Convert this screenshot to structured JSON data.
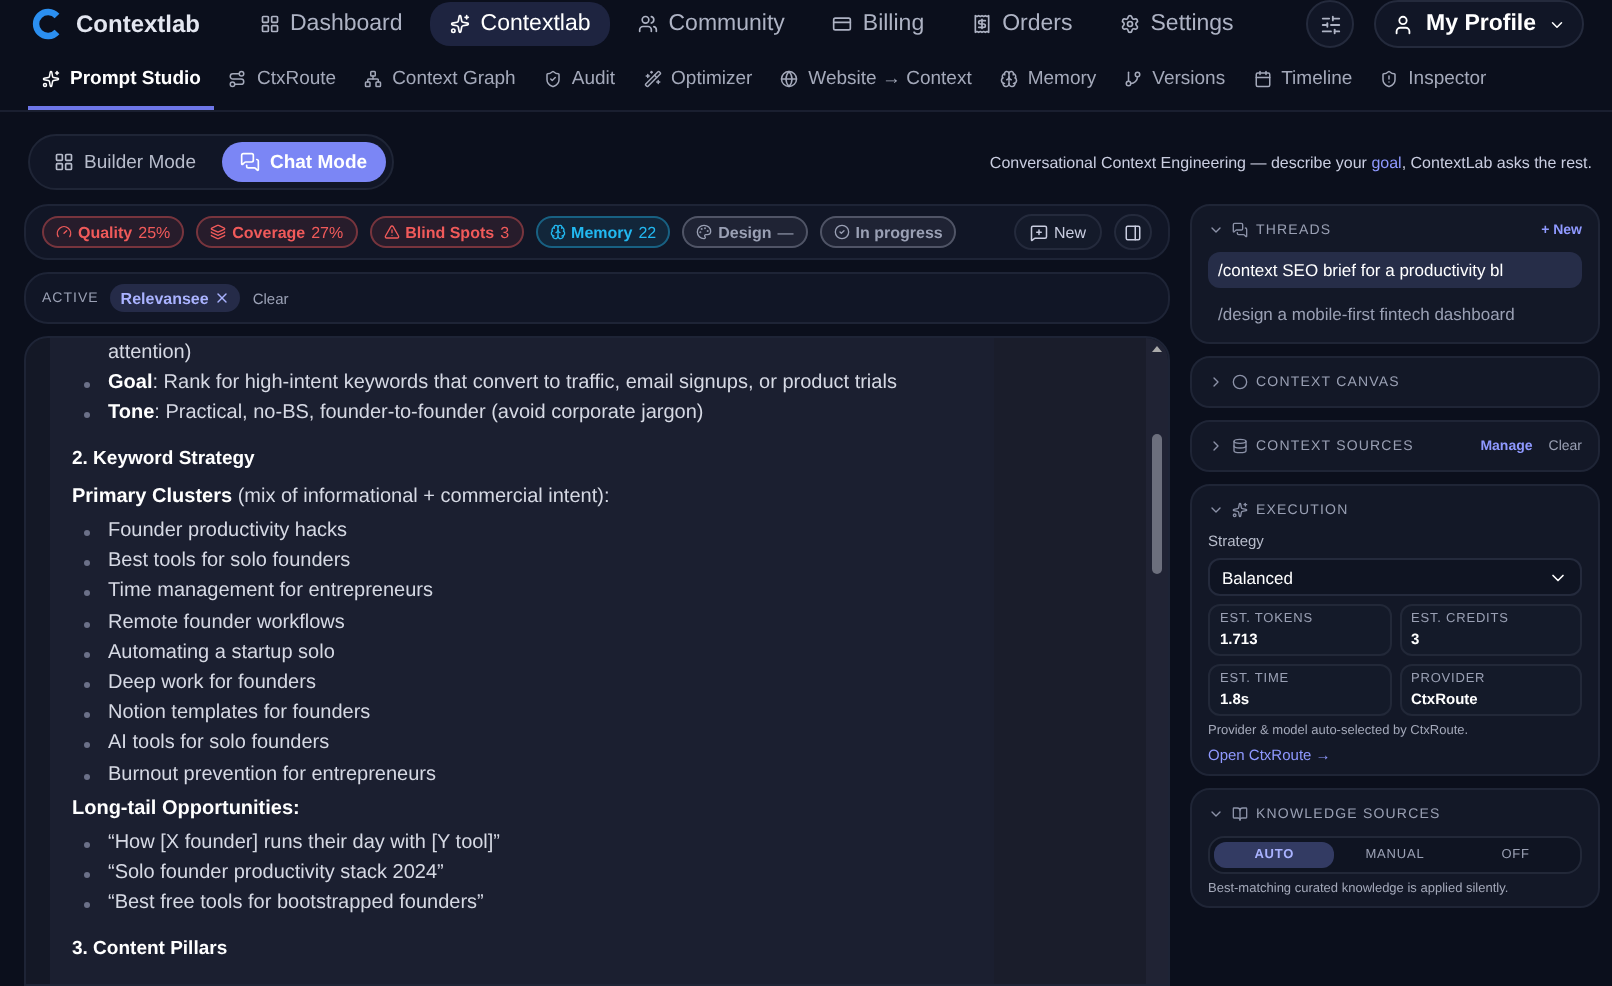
{
  "nav": {
    "brand": "Contextlab",
    "items": [
      {
        "label": "Dashboard",
        "selected": false
      },
      {
        "label": "Contextlab",
        "selected": true
      },
      {
        "label": "Community",
        "selected": false
      },
      {
        "label": "Billing",
        "selected": false
      },
      {
        "label": "Orders",
        "selected": false
      },
      {
        "label": "Settings",
        "selected": false
      }
    ],
    "profile": "My Profile"
  },
  "subtabs": [
    {
      "label": "Prompt Studio",
      "selected": true
    },
    {
      "label": "CtxRoute",
      "selected": false
    },
    {
      "label": "Context Graph",
      "selected": false
    },
    {
      "label": "Audit",
      "selected": false
    },
    {
      "label": "Optimizer",
      "selected": false
    },
    {
      "label": "Website → Context",
      "selected": false
    },
    {
      "label": "Memory",
      "selected": false
    },
    {
      "label": "Versions",
      "selected": false
    },
    {
      "label": "Timeline",
      "selected": false
    },
    {
      "label": "Inspector",
      "selected": false
    }
  ],
  "modes": [
    {
      "label": "Builder Mode",
      "selected": false
    },
    {
      "label": "Chat Mode",
      "selected": true
    }
  ],
  "tagline": "Conversational Context Engineering — describe your **goal**, ContextLab asks the rest.",
  "metrics": [
    {
      "label": "Quality",
      "value": "25%",
      "color": "#f05a5a"
    },
    {
      "label": "Coverage",
      "value": "27%",
      "color": "#f05a5a"
    },
    {
      "label": "Blind Spots",
      "value": "3",
      "color": "#f05a5a"
    },
    {
      "label": "Memory",
      "value": "22",
      "color": "#22b8f0"
    },
    {
      "label": "Design",
      "value": "—",
      "color": "#9aa0b4"
    },
    {
      "label": "In progress",
      "color": "#9aa0b4"
    }
  ],
  "new_button": "New",
  "active": {
    "label": "ACTIVE",
    "tags": [
      "Relevansee"
    ],
    "clear": "Clear"
  },
  "content": [
    {
      "kind": "continuation",
      "text": "attention)"
    },
    {
      "kind": "bullet",
      "text": "**Goal**: Rank for high-intent keywords that convert to traffic, email signups, or product trials"
    },
    {
      "kind": "bullet",
      "text": "**Tone**: Practical, no-BS, founder-to-founder (avoid corporate jargon)"
    },
    {
      "kind": "heading",
      "text": "2. Keyword Strategy"
    },
    {
      "kind": "para",
      "text": "**Primary Clusters** (mix of informational + commercial intent):"
    },
    {
      "kind": "bullet",
      "text": "Founder productivity hacks"
    },
    {
      "kind": "bullet",
      "text": "Best tools for solo founders"
    },
    {
      "kind": "bullet",
      "text": "Time management for entrepreneurs"
    },
    {
      "kind": "bullet",
      "text": "Remote founder workflows"
    },
    {
      "kind": "bullet",
      "text": "Automating a startup solo"
    },
    {
      "kind": "bullet",
      "text": "Deep work for founders"
    },
    {
      "kind": "bullet",
      "text": "Notion templates for founders"
    },
    {
      "kind": "bullet",
      "text": "AI tools for solo founders"
    },
    {
      "kind": "bullet",
      "text": "Burnout prevention for entrepreneurs"
    },
    {
      "kind": "para",
      "text": "**Long-tail Opportunities:**"
    },
    {
      "kind": "bullet",
      "text": "“How [X founder] runs their day with [Y tool]”"
    },
    {
      "kind": "bullet",
      "text": "“Solo founder productivity stack 2024”"
    },
    {
      "kind": "bullet",
      "text": "“Best free tools for bootstrapped founders”"
    },
    {
      "kind": "heading",
      "text": "3. Content Pillars"
    }
  ],
  "sidebar": {
    "threads": {
      "title": "THREADS",
      "expanded": true,
      "new": "+ New",
      "items": [
        {
          "label": "/context SEO brief for a productivity bl",
          "selected": true
        },
        {
          "label": "/design a mobile-first fintech dashboard",
          "selected": false
        }
      ]
    },
    "canvas": {
      "title": "CONTEXT CANVAS",
      "expanded": false
    },
    "sources": {
      "title": "CONTEXT SOURCES",
      "expanded": false,
      "manage": "Manage",
      "clear": "Clear"
    },
    "execution": {
      "title": "EXECUTION",
      "expanded": true,
      "strategy_label": "Strategy",
      "strategy": "Balanced",
      "stats": [
        {
          "label": "EST. TOKENS",
          "value": "1.713"
        },
        {
          "label": "EST. CREDITS",
          "value": "3"
        },
        {
          "label": "EST. TIME",
          "value": "1.8s"
        },
        {
          "label": "PROVIDER",
          "value": "CtxRoute"
        }
      ],
      "note": "Provider & model auto-selected by CtxRoute.",
      "link": "Open CtxRoute →"
    },
    "knowledge": {
      "title": "KNOWLEDGE SOURCES",
      "expanded": true,
      "options": [
        {
          "label": "AUTO",
          "selected": true
        },
        {
          "label": "MANUAL",
          "selected": false
        },
        {
          "label": "OFF",
          "selected": false
        }
      ],
      "note": "Best-matching curated knowledge is applied silently."
    }
  }
}
